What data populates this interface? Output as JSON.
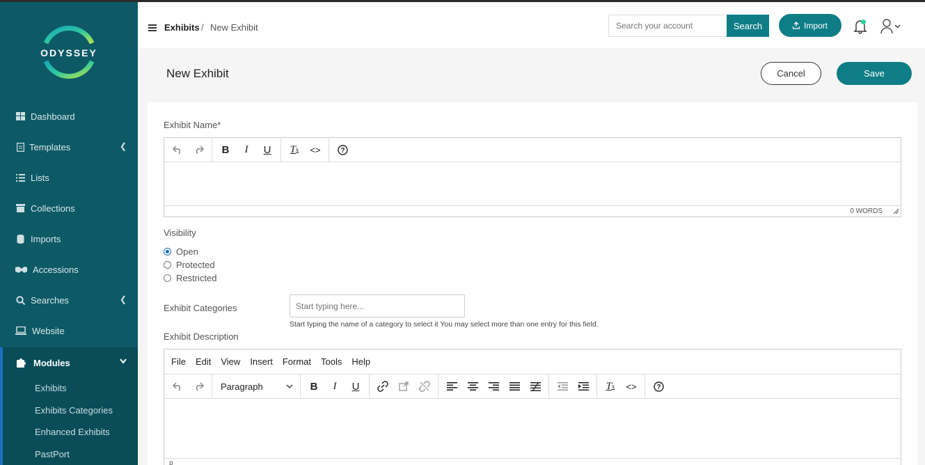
{
  "brand": {
    "logo_text": "ODYSSEY",
    "accent": "#0e7d86",
    "sidebar_bg": "#0d5a66",
    "active_border": "#1b6fbf"
  },
  "sidebar": {
    "items": [
      {
        "label": "Dashboard",
        "icon": "dashboard-icon"
      },
      {
        "label": "Templates",
        "icon": "document-icon"
      },
      {
        "label": "Lists",
        "icon": "list-icon"
      },
      {
        "label": "Collections",
        "icon": "archive-icon"
      },
      {
        "label": "Imports",
        "icon": "database-icon"
      },
      {
        "label": "Accessions",
        "icon": "handshake-icon"
      },
      {
        "label": "Searches",
        "icon": "search-icon"
      },
      {
        "label": "Website",
        "icon": "laptop-icon"
      },
      {
        "label": "Modules",
        "icon": "puzzle-icon"
      }
    ],
    "subitems": [
      "Exhibits",
      "Exhibits Categories",
      "Enhanced Exhibits",
      "PastPort"
    ]
  },
  "header": {
    "breadcrumb_root": "Exhibits",
    "breadcrumb_sep": "/",
    "breadcrumb_current": "New Exhibit",
    "search_placeholder": "Search your account",
    "search_label": "Search",
    "import_label": "Import"
  },
  "page": {
    "title": "New Exhibit",
    "cancel_label": "Cancel",
    "save_label": "Save"
  },
  "form": {
    "name_label": "Exhibit Name*",
    "word_count": "0 WORDS",
    "visibility_label": "Visibility",
    "visibility_options": [
      "Open",
      "Protected",
      "Restricted"
    ],
    "visibility_selected": "Open",
    "categories_label": "Exhibit Categories",
    "categories_placeholder": "Start typing here...",
    "categories_help": "Start typing the name of a category to select it You may select more than one entry for this field.",
    "description_label": "Exhibit Description",
    "menu": [
      "File",
      "Edit",
      "View",
      "Insert",
      "Format",
      "Tools",
      "Help"
    ],
    "block_format": "Paragraph",
    "status_path": "p"
  }
}
